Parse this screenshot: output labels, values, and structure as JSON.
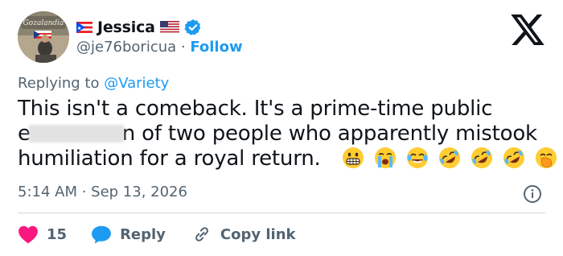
{
  "author": {
    "display_name": "Jessica",
    "handle": "@je76boricua",
    "separator": " · ",
    "follow_label": "Follow",
    "avatar_text": "Gozalandia",
    "flags": [
      "puerto-rico-flag",
      "us-flag"
    ],
    "verified_icon": "verified-badge-icon"
  },
  "brand": {
    "logo": "x-logo-icon"
  },
  "tweet": {
    "reply_prefix": "Replying to ",
    "reply_target": "@Variety",
    "lines": [
      "This isn't a comeback. It's a prime-time public",
      [
        "e",
        "n of two people who apparently mistook"
      ],
      "humiliation for a royal return."
    ],
    "emojis": [
      "grimacing-face-icon",
      "loudly-crying-face-icon",
      "tears-of-joy-face-icon",
      "rolling-laughing-face-icon",
      "rolling-laughing-face-icon",
      "rolling-laughing-face-icon",
      "hand-over-mouth-face-icon"
    ],
    "timestamp": "5:14 AM · Sep 13, 2026"
  },
  "actions": {
    "like_count": "15",
    "reply_label": "Reply",
    "copy_label": "Copy link"
  },
  "colors": {
    "accent": "#1d9bf0",
    "like": "#f91880",
    "text": "#0f1419",
    "muted": "#536471"
  }
}
